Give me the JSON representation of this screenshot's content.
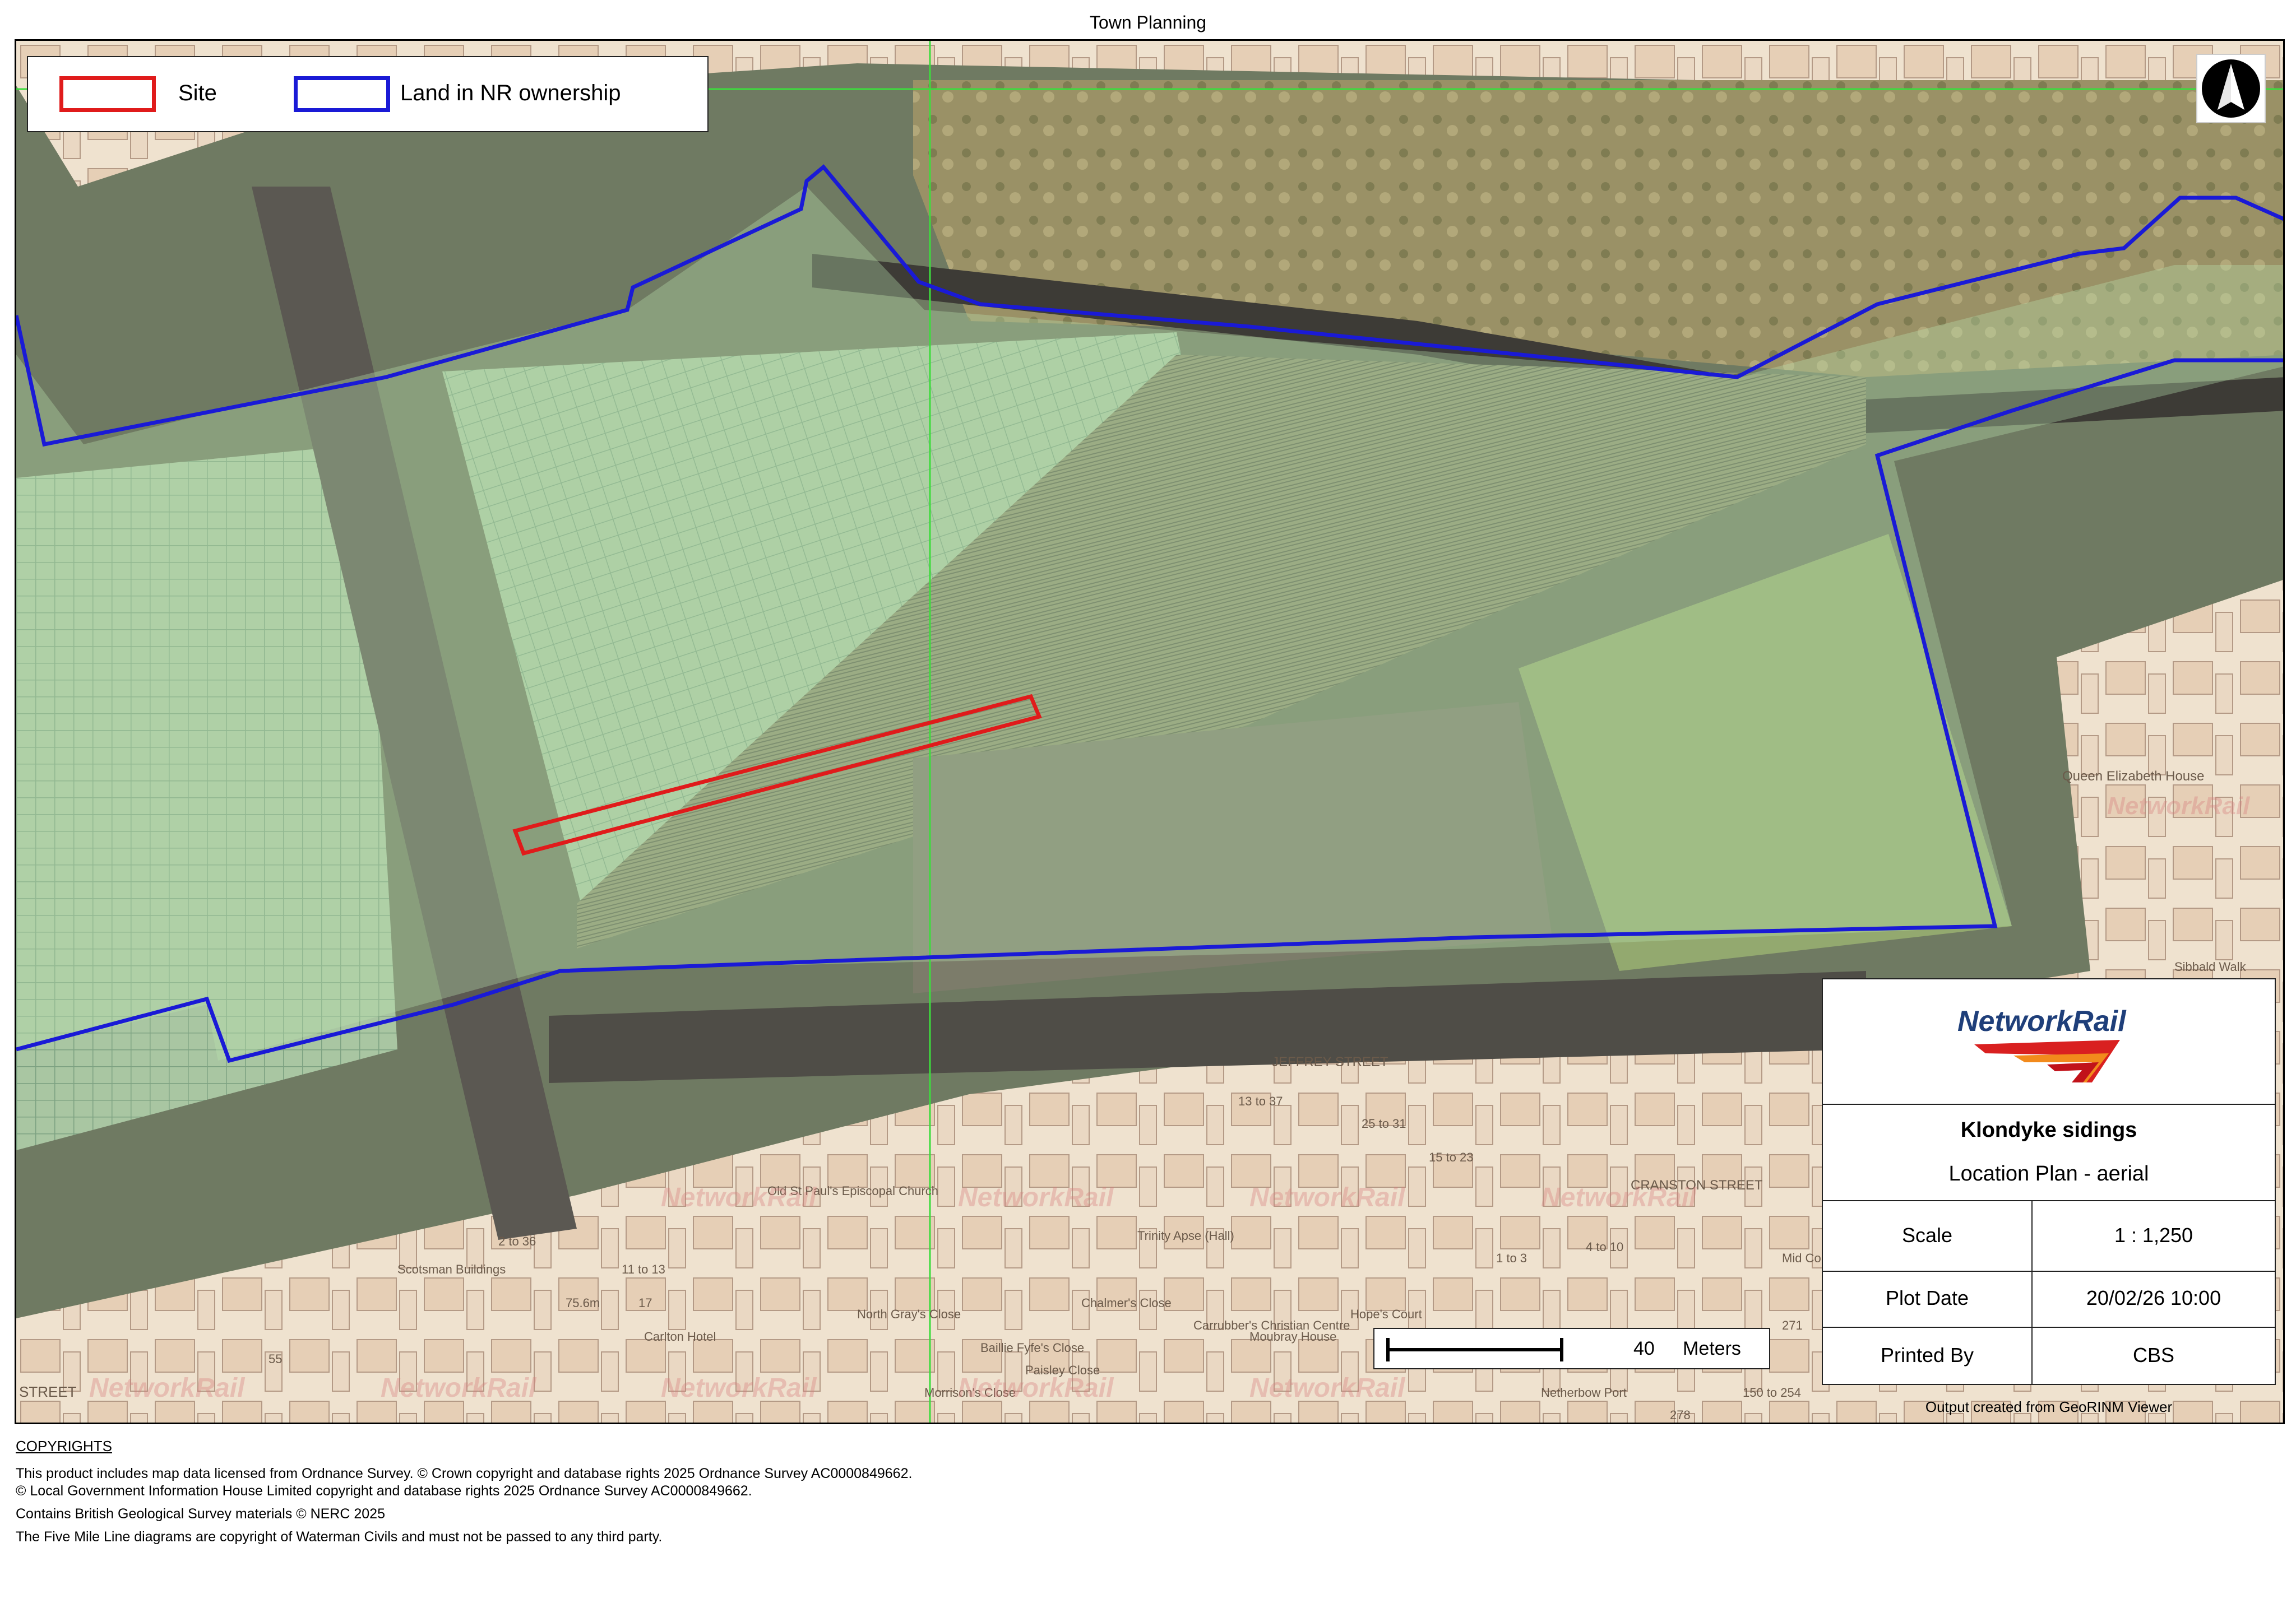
{
  "header": {
    "title": "Town Planning"
  },
  "legend": {
    "items": [
      {
        "label": "Site",
        "color": "#e01b1b"
      },
      {
        "label": "Land in NR ownership",
        "color": "#1a1ad6"
      }
    ]
  },
  "map": {
    "colors": {
      "site": "#e01b1b",
      "nr_land": "#1a1ad6",
      "grid_line": "#3ddc3d",
      "osmap_bg": "#efe2cf"
    },
    "labels": [
      "Queen Elizabeth House",
      "Sibbald Walk",
      "Trinity Apse (Hall)",
      "Scotsman Buildings",
      "Carlton Hotel",
      "75.6m",
      "North Gray's Close",
      "Chalmer's Close",
      "Baillie Fyfe's Close",
      "Paisley Close",
      "Morrison's Close",
      "Hope's Court",
      "Carrubber's Christian Centre",
      "Moubray House",
      "Netherbow Port",
      "CRANSTON STREET",
      "JEFFREY STREET",
      "Old St Paul's Episcopal Church",
      "11 to 13",
      "13 to 37",
      "25 to 31",
      "15 to 23",
      "4 to 10",
      "1 to 3",
      "2 to 36",
      "55",
      "17",
      "STREET",
      "Mid Common",
      "271",
      "150 to 254",
      "278"
    ],
    "watermark": "NetworkRail"
  },
  "north_arrow": {
    "icon": "north-arrow-icon"
  },
  "scale_bar": {
    "value": "40",
    "unit": "Meters"
  },
  "title_block": {
    "logo_text": "NetworkRail",
    "project": "Klondyke sidings",
    "drawing": "Location Plan - aerial",
    "rows": [
      {
        "label": "Scale",
        "value": "1 : 1,250"
      },
      {
        "label": "Plot Date",
        "value": "20/02/26 10:00"
      },
      {
        "label": "Printed By",
        "value": "CBS"
      }
    ]
  },
  "output_note": "Output created from GeoRINM Viewer",
  "copyrights": {
    "heading": "COPYRIGHTS",
    "lines": [
      "This product includes map data licensed from Ordnance Survey. © Crown copyright and database rights 2025 Ordnance Survey AC0000849662.",
      "© Local Government Information House Limited copyright and database rights 2025 Ordnance Survey AC0000849662.",
      "Contains British Geological Survey materials © NERC 2025",
      "The Five Mile Line diagrams are copyright of Waterman Civils and must not be passed to any third party."
    ]
  }
}
